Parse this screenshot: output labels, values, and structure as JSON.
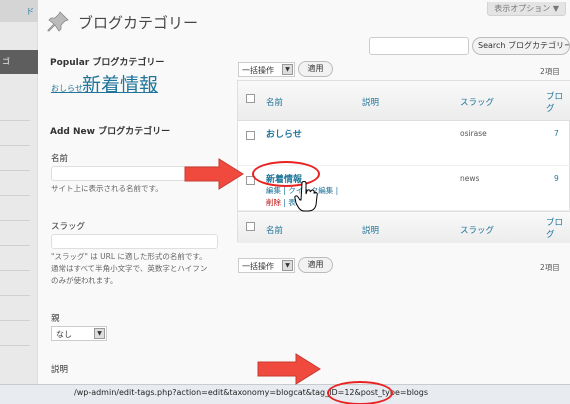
{
  "sidebar": {
    "top_label": "ド",
    "active_label": "ゴ"
  },
  "header": {
    "screen_options": "表示オプション ▼",
    "title": "ブログカテゴリー"
  },
  "search": {
    "button": "Search ブログカテゴリー"
  },
  "popular": {
    "heading": "Popular ブログカテゴリー",
    "tags": [
      {
        "label": "おしらせ"
      },
      {
        "label": "新着情報"
      }
    ]
  },
  "add_new": {
    "heading": "Add New ブログカテゴリー",
    "name_label": "名前",
    "name_desc": "サイト上に表示される名前です。",
    "slug_label": "スラッグ",
    "slug_desc_1": "\"スラッグ\" は URL に適した形式の名前です。",
    "slug_desc_2": "通常はすべて半角小文字で、英数字とハイフン",
    "slug_desc_3": "のみが使われます。",
    "parent_label": "親",
    "parent_value": "なし",
    "desc_label": "説明"
  },
  "table": {
    "bulk_label": "一括操作",
    "apply_label": "適用",
    "count_text": "2項目",
    "columns": {
      "name": "名前",
      "description": "説明",
      "slug": "スラッグ",
      "posts_line1": "ブロ",
      "posts_line2": "グ"
    },
    "rows": [
      {
        "name": "おしらせ",
        "slug": "osirase",
        "count": "7"
      },
      {
        "name": "新着情報",
        "slug": "news",
        "count": "9"
      }
    ],
    "row_actions": {
      "edit": "編集",
      "quick_edit": "クイック編集",
      "delete": "削除",
      "view": "表示"
    }
  },
  "statusbar": {
    "url": "/wp-admin/edit-tags.php?action=edit&taxonomy=blogcat&tag_ID=12&post_type=blogs"
  },
  "colors": {
    "link": "#21759b",
    "annotation": "#e82222",
    "arrow": "#f04a3f"
  }
}
